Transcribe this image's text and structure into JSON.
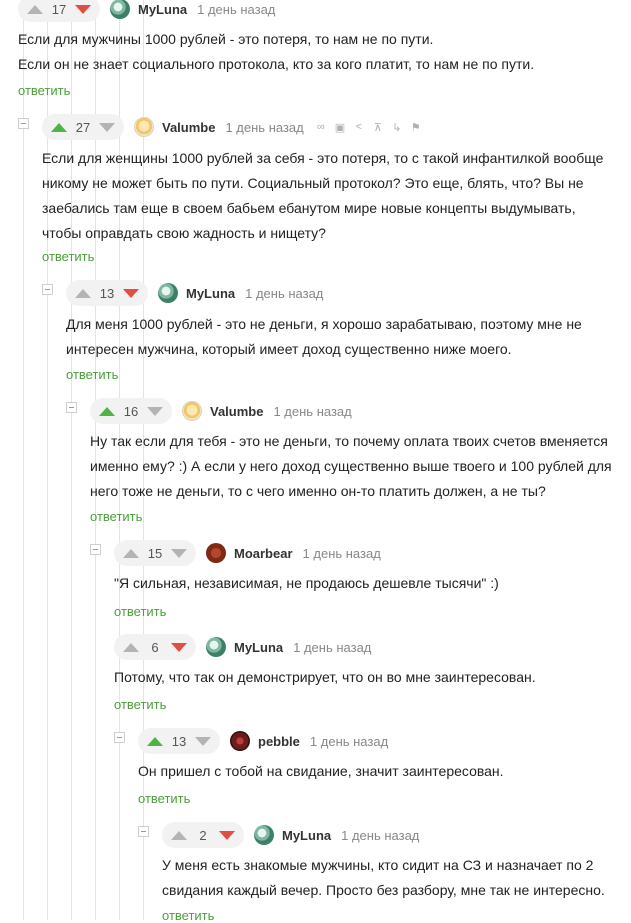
{
  "labels": {
    "reply": "ответить"
  },
  "comments": [
    {
      "rating": "17",
      "vote": "down",
      "author": "MyLuna",
      "time": "1 день назад",
      "text": [
        "Если для мужчины 1000 рублей - это потеря, то нам не по пути.",
        "Если он не знает социального протокола, кто за кого платит, то нам не по пути."
      ]
    },
    {
      "rating": "27",
      "vote": "up",
      "author": "Valumbe",
      "time": "1 день назад",
      "actions": [
        "link-icon",
        "save-icon",
        "share-icon",
        "branch-up-icon",
        "branch-icon",
        "flag-icon"
      ],
      "text": [
        "Если для женщины 1000 рублей за себя - это потеря, то с такой инфантилкой вообще",
        "никому не может быть по пути. Социальный протокол? Это еще, блять, что? Вы не",
        "заебались там еще в своем бабьем ебанутом мире новые концепты выдумывать,",
        "чтобы оправдать свою жадность и нищету?"
      ]
    },
    {
      "rating": "13",
      "vote": "down",
      "author": "MyLuna",
      "time": "1 день назад",
      "text": [
        "Для меня 1000 рублей - это не деньги, я хорошо зарабатываю, поэтому мне не",
        "интересен мужчина, который имеет доход существенно ниже моего."
      ]
    },
    {
      "rating": "16",
      "vote": "up",
      "author": "Valumbe",
      "time": "1 день назад",
      "text": [
        "Ну так если для тебя - это не деньги, то почему оплата твоих счетов вменяется",
        "именно ему? :) А если у него доход существенно выше твоего и 100  рублей для",
        "него тоже не деньги, то с чего именно он-то платить должен, а не ты?"
      ]
    },
    {
      "rating": "15",
      "vote": "none",
      "author": "Moarbear",
      "time": "1 день назад",
      "text": [
        "\"Я сильная, независимая, не продаюсь дешевле тысячи\" :)"
      ]
    },
    {
      "rating": "6",
      "vote": "down",
      "author": "MyLuna",
      "time": "1 день назад",
      "text": [
        "Потому, что так он демонстрирует, что он во мне заинтересован."
      ]
    },
    {
      "rating": "13",
      "vote": "up",
      "author": "pebble",
      "time": "1 день назад",
      "text": [
        "Он пришел с тобой на свидание, значит заинтересован."
      ]
    },
    {
      "rating": "2",
      "vote": "down",
      "author": "MyLuna",
      "time": "1 день назад",
      "text": [
        "У меня есть знакомые мужчины, кто сидит на СЗ и назначает по 2",
        "свидания каждый вечер. Просто без разбору, мне так не интересно."
      ]
    }
  ]
}
